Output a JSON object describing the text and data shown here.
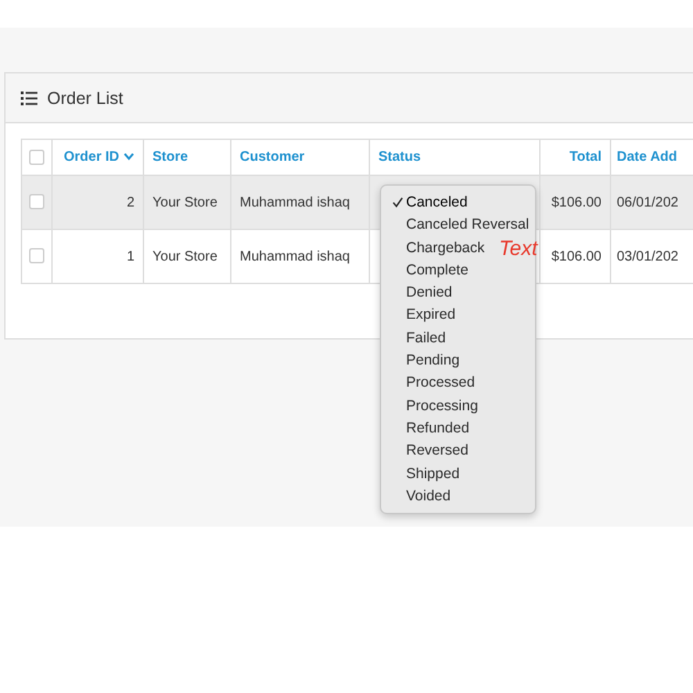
{
  "panel": {
    "title": "Order List"
  },
  "table": {
    "select_all_checked": false,
    "columns": [
      {
        "label": "Order ID",
        "sorted": true,
        "kind": "number"
      },
      {
        "label": "Store",
        "sorted": false,
        "kind": "text"
      },
      {
        "label": "Customer",
        "sorted": false,
        "kind": "text"
      },
      {
        "label": "Status",
        "sorted": false,
        "kind": "text"
      },
      {
        "label": "Total",
        "sorted": false,
        "kind": "number"
      },
      {
        "label": "Date Add",
        "sorted": false,
        "kind": "text"
      }
    ],
    "rows": [
      {
        "checked": false,
        "hovered": true,
        "cells": [
          "2",
          "Your Store",
          "Muhammad ishaq",
          "",
          "$106.00",
          "06/01/202"
        ]
      },
      {
        "checked": false,
        "hovered": false,
        "cells": [
          "1",
          "Your Store",
          "Muhammad ishaq",
          "",
          "$106.00",
          "03/01/202"
        ]
      }
    ]
  },
  "status_menu": {
    "options": [
      {
        "label": "Canceled",
        "selected": true
      },
      {
        "label": "Canceled Reversal",
        "selected": false
      },
      {
        "label": "Chargeback",
        "selected": false
      },
      {
        "label": "Complete",
        "selected": false
      },
      {
        "label": "Denied",
        "selected": false
      },
      {
        "label": "Expired",
        "selected": false
      },
      {
        "label": "Failed",
        "selected": false
      },
      {
        "label": "Pending",
        "selected": false
      },
      {
        "label": "Processed",
        "selected": false
      },
      {
        "label": "Processing",
        "selected": false
      },
      {
        "label": "Refunded",
        "selected": false
      },
      {
        "label": "Reversed",
        "selected": false
      },
      {
        "label": "Shipped",
        "selected": false
      },
      {
        "label": "Voided",
        "selected": false
      }
    ]
  },
  "annotation": "Text"
}
